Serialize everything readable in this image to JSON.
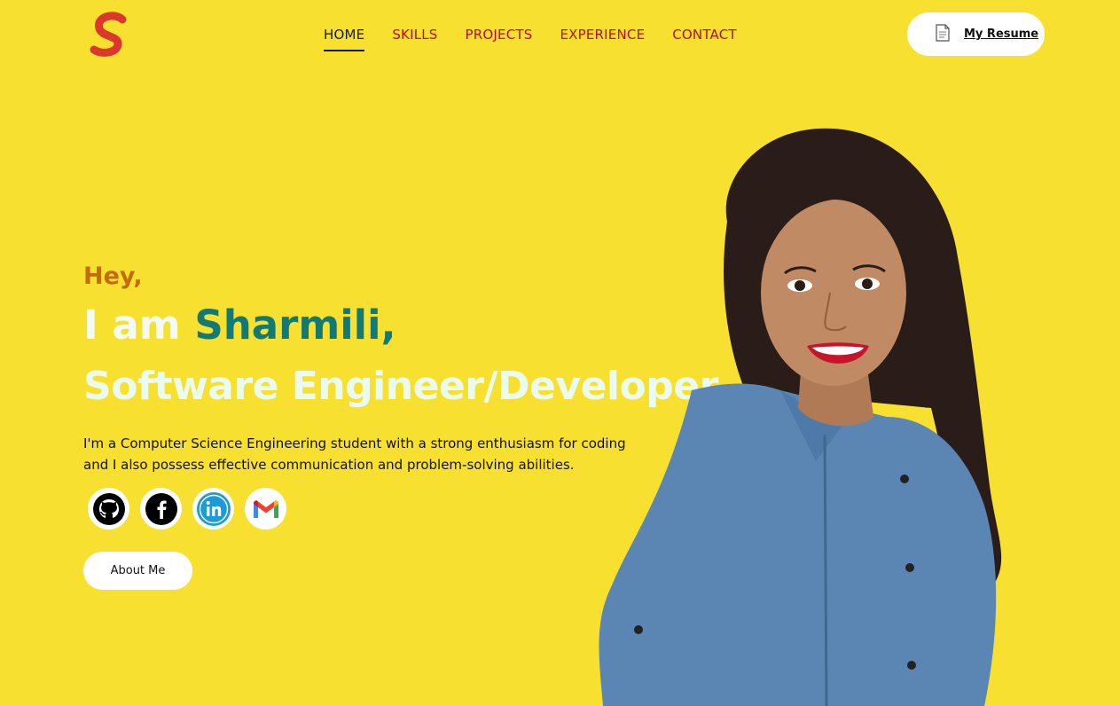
{
  "header": {
    "logo_letter": "S",
    "nav": [
      {
        "label": "HOME",
        "active": true
      },
      {
        "label": "SKILLS",
        "active": false
      },
      {
        "label": "PROJECTS",
        "active": false
      },
      {
        "label": "EXPERIENCE",
        "active": false
      },
      {
        "label": "CONTACT",
        "active": false
      }
    ],
    "resume_label": "My Resume",
    "resume_icon": "document-icon"
  },
  "hero": {
    "greeting": "Hey,",
    "iam_prefix": "I am ",
    "name": "Sharmili,",
    "role": "Software Engineer/Developer.",
    "description": "I'm a Computer Science Engineering student with a strong enthusiasm for coding and I also possess effective communication and problem-solving abilities.",
    "socials": [
      {
        "icon": "github-icon"
      },
      {
        "icon": "facebook-icon"
      },
      {
        "icon": "linkedin-icon"
      },
      {
        "icon": "gmail-icon"
      }
    ],
    "about_label": "About Me"
  },
  "colors": {
    "background": "#f7e02f",
    "nav_text": "#b8101a",
    "greeting": "#c46a10",
    "name_accent": "#127a74",
    "headline": "#eafbf0"
  }
}
